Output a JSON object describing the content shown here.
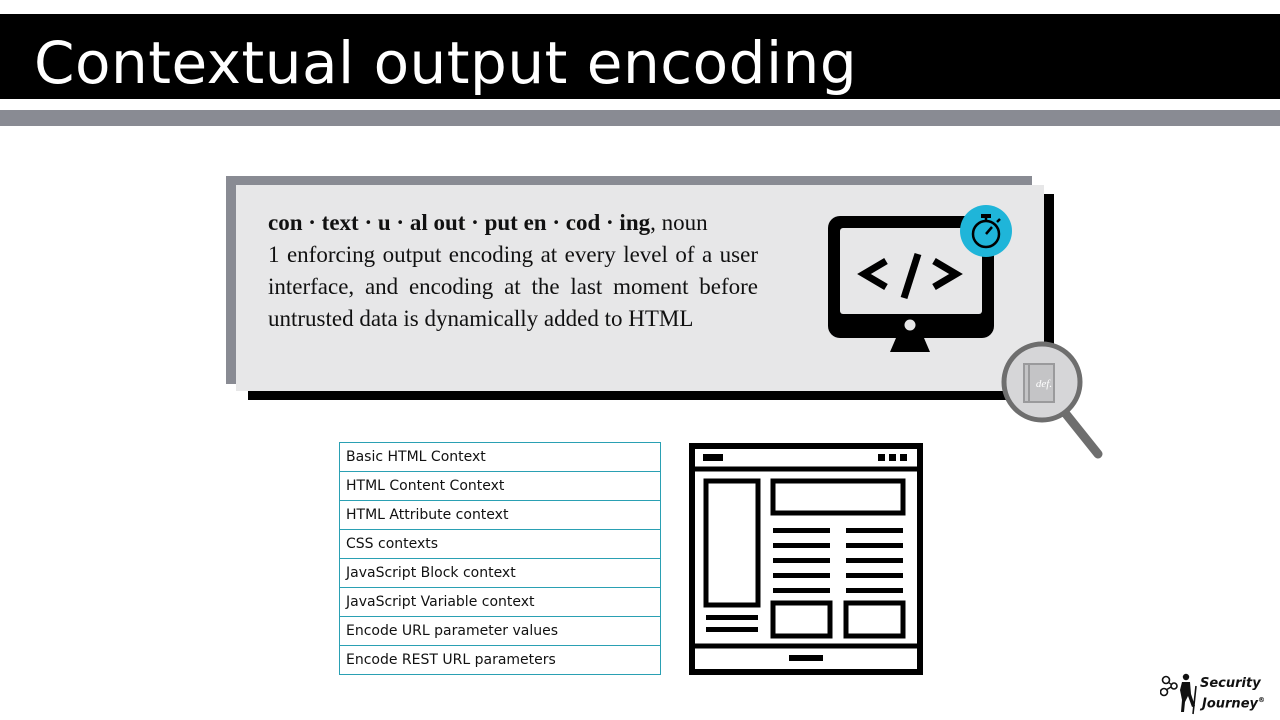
{
  "slide": {
    "title": "Contextual output encoding"
  },
  "definition": {
    "term": "con · text · u · al out · put en · cod · ing",
    "part_of_speech": ", noun",
    "sense": "1 enforcing output encoding at every level of a user interface, and encoding at the last moment before untrusted data is dynamically added to HTML"
  },
  "magnifier_label": "def.",
  "contexts": [
    "Basic HTML Context",
    "HTML Content Context",
    "HTML Attribute context",
    "CSS contexts",
    "JavaScript Block context",
    "JavaScript Variable context",
    "Encode URL parameter values",
    "Encode REST URL parameters"
  ],
  "logo": {
    "line1": "Security",
    "line2": "Journey",
    "mark": "®"
  },
  "icons": {
    "monitor": "monitor-code-icon",
    "stopwatch": "stopwatch-icon",
    "magnifier": "magnifying-glass-book-icon",
    "browser": "web-page-layout-icon"
  },
  "colors": {
    "title_bar": "#000000",
    "rule": "#898b93",
    "definition_bg": "#e7e7e8",
    "table_border": "#2aa0b3",
    "stopwatch_bg": "#1fb5d9"
  }
}
